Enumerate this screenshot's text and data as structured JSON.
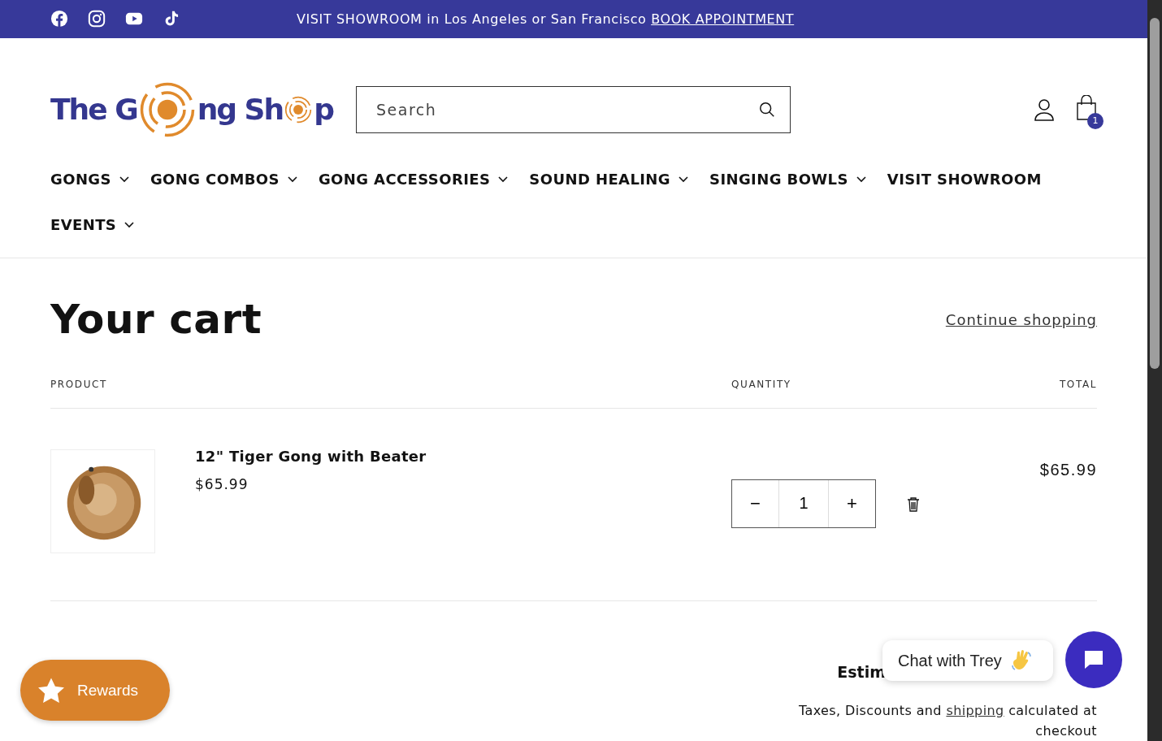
{
  "announcement": {
    "text": "VISIT SHOWROOM in Los Angeles or San Francisco",
    "link": "BOOK APPOINTMENT"
  },
  "social": [
    {
      "kind": "facebook"
    },
    {
      "kind": "instagram"
    },
    {
      "kind": "youtube"
    },
    {
      "kind": "tiktok"
    }
  ],
  "logo": {
    "parts": [
      "The G",
      "ng Sh",
      "p"
    ]
  },
  "search": {
    "placeholder": "Search"
  },
  "cart_count": "1",
  "nav": [
    {
      "label": "GONGS",
      "dropdown": true
    },
    {
      "label": "GONG COMBOS",
      "dropdown": true
    },
    {
      "label": "GONG ACCESSORIES",
      "dropdown": true
    },
    {
      "label": "SOUND HEALING",
      "dropdown": true
    },
    {
      "label": "SINGING BOWLS",
      "dropdown": true
    },
    {
      "label": "VISIT SHOWROOM",
      "dropdown": false
    },
    {
      "label": "EVENTS",
      "dropdown": true
    }
  ],
  "cart": {
    "title": "Your cart",
    "continue": "Continue shopping",
    "columns": [
      "PRODUCT",
      "QUANTITY",
      "TOTAL"
    ],
    "items": [
      {
        "name": "12\" Tiger Gong with Beater",
        "price": "$65.99",
        "quantity": "1",
        "minus": "−",
        "plus": "+",
        "total": "$65.99"
      }
    ],
    "estimated": {
      "label": "Estim"
    },
    "note": {
      "before": "Taxes, Discounts and",
      "link": "shipping",
      "after": "calculated at checkout"
    }
  },
  "rewards": {
    "label": "Rewards"
  },
  "chat": {
    "label": "Chat with Trey"
  }
}
